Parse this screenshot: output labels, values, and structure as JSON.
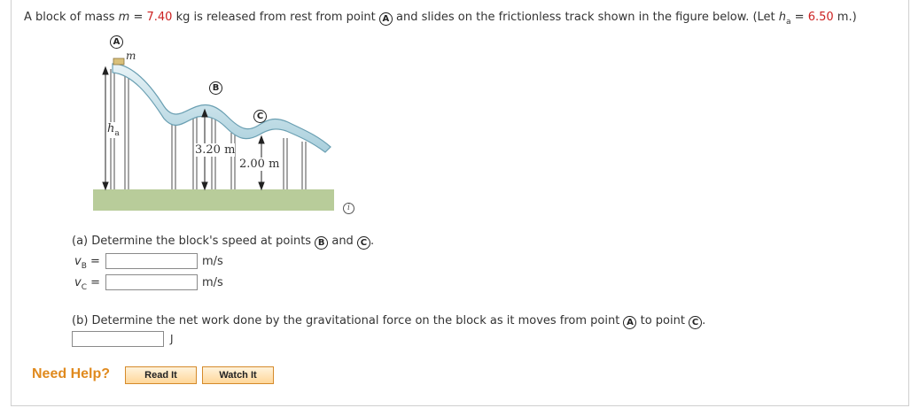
{
  "problem": {
    "text1": "A block of mass",
    "mass_var": "m",
    "eq": " = ",
    "mass_value": "7.40",
    "mass_unit": " kg is released from rest from point ",
    "point_start": "A",
    "text2": " and slides on the frictionless track shown in the figure below. (Let ",
    "h_var": "h",
    "h_sub": "a",
    "h_value": "6.50",
    "h_unit": " m.)"
  },
  "figure": {
    "label_a": "A",
    "label_b": "B",
    "label_c": "C",
    "label_m": "m",
    "label_ha": "h",
    "label_ha_sub": "a",
    "height_b": "3.20 m",
    "height_c": "2.00 m"
  },
  "info_icon": "i",
  "part_a": {
    "prompt": "(a) Determine the block's speed at points ",
    "point_b": "B",
    "and": " and ",
    "point_c": "C",
    "end": ".",
    "vb_label": "v",
    "vb_sub": "B",
    "vc_label": "v",
    "vc_sub": "C",
    "eq": " =",
    "vb_value": "",
    "vc_value": "",
    "unit": "m/s"
  },
  "part_b": {
    "prompt": "(b) Determine the net work done by the gravitational force on the block as it moves from point ",
    "point_a": "A",
    "to": " to point ",
    "point_c": "C",
    "end": ".",
    "value": "",
    "unit": "J"
  },
  "help": {
    "label": "Need Help?",
    "read_it": "Read It",
    "watch_it": "Watch It"
  }
}
